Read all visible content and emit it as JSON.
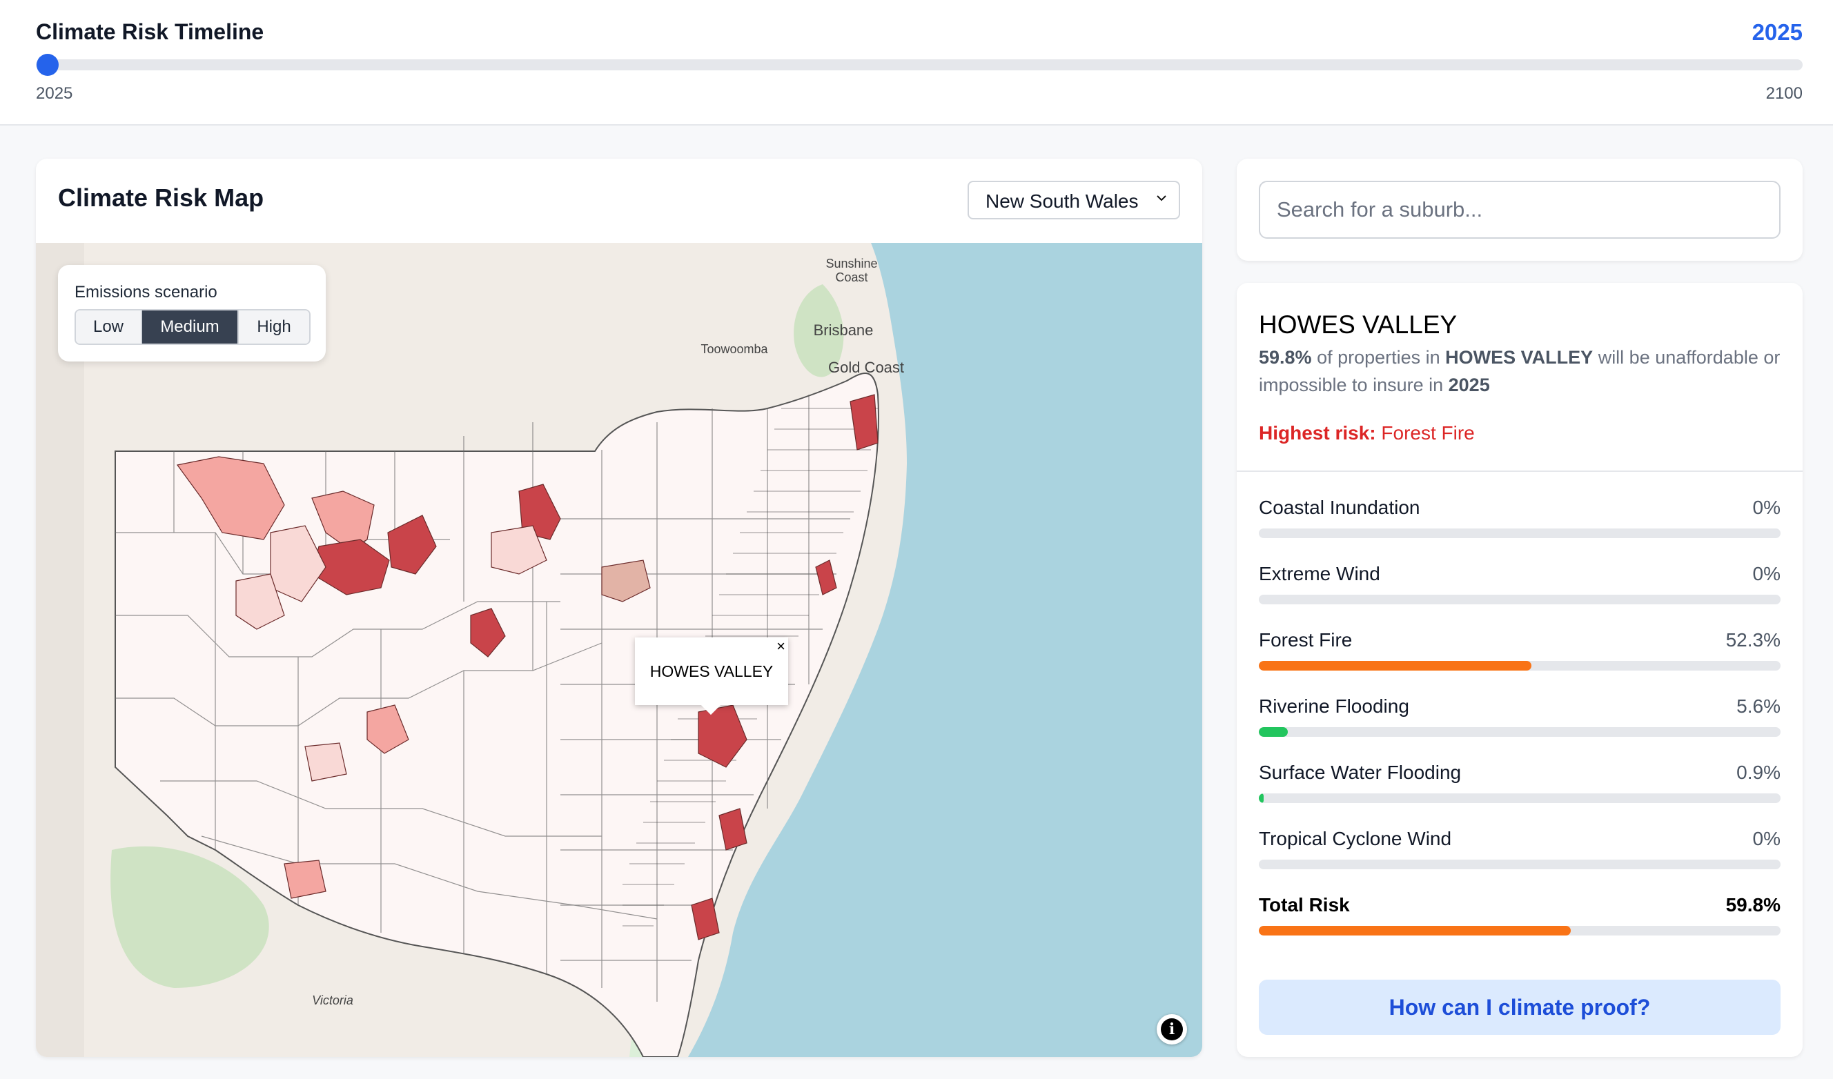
{
  "timeline": {
    "title": "Climate Risk Timeline",
    "current_year": "2025",
    "min_label": "2025",
    "max_label": "2100",
    "position_fraction": 0.0
  },
  "map_panel": {
    "title": "Climate Risk Map",
    "state_select": {
      "value": "New South Wales",
      "icon": "chevron-down-icon"
    },
    "emissions": {
      "label": "Emissions scenario",
      "options": [
        "Low",
        "Medium",
        "High"
      ],
      "selected": "Medium"
    },
    "places": [
      "Sunshine",
      "Coast",
      "Brisbane",
      "Gold Coast",
      "Toowoomba",
      "Victoria"
    ],
    "popup": {
      "text": "HOWES VALLEY",
      "close": "×"
    },
    "info_icon": "info-icon",
    "colors": {
      "sea": "#aad3df",
      "land": "#f1ece6",
      "low_risk": "#f9d9d6",
      "mid_risk": "#f4a6a1",
      "high_risk": "#c9444a",
      "green_low": "#dcefd9"
    }
  },
  "search": {
    "placeholder": "Search for a suburb..."
  },
  "detail": {
    "suburb": "HOWES VALLEY",
    "summary": {
      "pct": "59.8%",
      "text1": " of properties in ",
      "suburb": "HOWES VALLEY",
      "text2": " will be unaffordable or impossible to insure in ",
      "year": "2025"
    },
    "highest_label": "Highest risk:",
    "highest_value": "Forest Fire",
    "risks": [
      {
        "name": "Coastal Inundation",
        "pct": "0%",
        "value": 0,
        "color": "#22c55e"
      },
      {
        "name": "Extreme Wind",
        "pct": "0%",
        "value": 0,
        "color": "#22c55e"
      },
      {
        "name": "Forest Fire",
        "pct": "52.3%",
        "value": 52.3,
        "color": "#f97316"
      },
      {
        "name": "Riverine Flooding",
        "pct": "5.6%",
        "value": 5.6,
        "color": "#22c55e"
      },
      {
        "name": "Surface Water Flooding",
        "pct": "0.9%",
        "value": 0.9,
        "color": "#22c55e"
      },
      {
        "name": "Tropical Cyclone Wind",
        "pct": "0%",
        "value": 0,
        "color": "#22c55e"
      }
    ],
    "total": {
      "name": "Total Risk",
      "pct": "59.8%",
      "value": 59.8,
      "color": "#f97316"
    },
    "cta": "How can I climate proof?"
  }
}
